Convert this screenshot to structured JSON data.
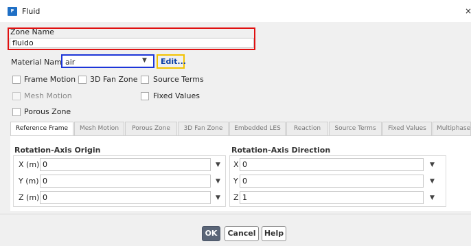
{
  "window": {
    "title": "Fluid",
    "icon_name": "ansys-fluent-icon",
    "icon_text": "F",
    "close_glyph": "×"
  },
  "zone": {
    "label": "Zone Name",
    "value": "fluido"
  },
  "material": {
    "label": "Material Name",
    "value": "air",
    "edit_label": "Edit..."
  },
  "checkboxes": {
    "frame_motion": "Frame Motion",
    "fan_zone_3d": "3D Fan Zone",
    "source_terms": "Source Terms",
    "mesh_motion": "Mesh Motion",
    "fixed_values": "Fixed Values",
    "porous_zone": "Porous Zone"
  },
  "tabs": [
    "Reference Frame",
    "Mesh Motion",
    "Porous Zone",
    "3D Fan Zone",
    "Embedded LES",
    "Reaction",
    "Source Terms",
    "Fixed Values",
    "Multiphase"
  ],
  "origin": {
    "title": "Rotation-Axis Origin",
    "rows": [
      {
        "label": "X (m)",
        "value": "0"
      },
      {
        "label": "Y (m)",
        "value": "0"
      },
      {
        "label": "Z (m)",
        "value": "0"
      }
    ]
  },
  "direction": {
    "title": "Rotation-Axis Direction",
    "rows": [
      {
        "label": "X",
        "value": "0"
      },
      {
        "label": "Y",
        "value": "0"
      },
      {
        "label": "Z",
        "value": "1"
      }
    ]
  },
  "buttons": {
    "ok": "OK",
    "cancel": "Cancel",
    "help": "Help"
  },
  "colors": {
    "highlight_zone": "#e01010",
    "highlight_material": "#1c35d8",
    "highlight_edit": "#f2c200"
  }
}
